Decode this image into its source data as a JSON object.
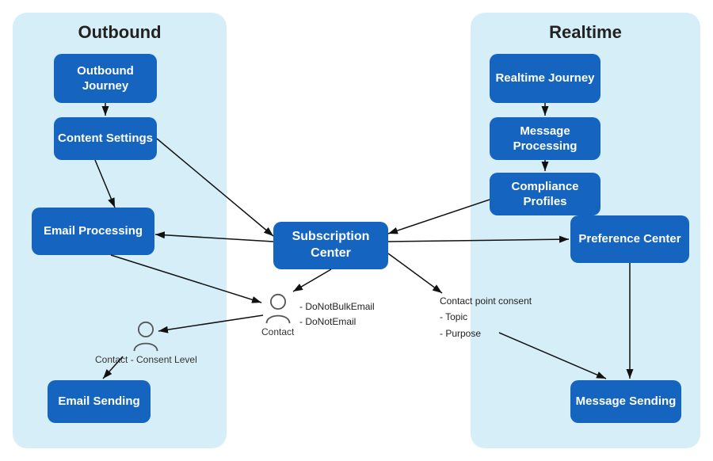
{
  "sections": {
    "outbound": {
      "title": "Outbound",
      "panel": "outbound"
    },
    "realtime": {
      "title": "Realtime",
      "panel": "realtime"
    }
  },
  "boxes": {
    "outbound_journey": {
      "label": "Outbound\nJourney"
    },
    "content_settings": {
      "label": "Content\nSettings"
    },
    "email_processing": {
      "label": "Email Processing"
    },
    "subscription_center": {
      "label": "Subscription\nCenter"
    },
    "email_sending": {
      "label": "Email\nSending"
    },
    "realtime_journey": {
      "label": "Realtime\nJourney"
    },
    "message_processing": {
      "label": "Message\nProcessing"
    },
    "compliance_profiles": {
      "label": "Compliance\nProfiles"
    },
    "preference_center": {
      "label": "Preference\nCenter"
    },
    "message_sending": {
      "label": "Message\nSending"
    }
  },
  "contacts": {
    "contact1": {
      "label": "Contact -  Consent Level"
    },
    "contact2": {
      "label": "Contact",
      "subLabel": "- DoNotBulkEmail\n- DoNotEmail"
    }
  },
  "labels": {
    "contact_point": "Contact point consent\n- Topic\n- Purpose"
  }
}
